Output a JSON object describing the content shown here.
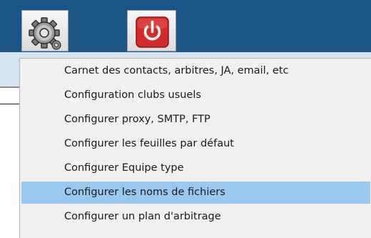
{
  "toolbar": {
    "settings_icon": "gear-icon",
    "power_icon": "power-icon"
  },
  "menu": {
    "selected_index": 5,
    "items": [
      {
        "label": "Carnet des contacts, arbitres, JA, email, etc"
      },
      {
        "label": "Configuration clubs usuels"
      },
      {
        "label": "Configurer proxy, SMTP, FTP"
      },
      {
        "label": "Configurer les feuilles par défaut"
      },
      {
        "label": "Configurer Equipe type"
      },
      {
        "label": "Configurer les noms de fichiers"
      },
      {
        "label": "Configurer un plan d'arbitrage"
      }
    ]
  },
  "colors": {
    "toolbar_bg": "#1b5585",
    "subbar_bg": "#d4e4f3",
    "menu_bg": "#f0f0f0",
    "highlight": "#99c9ef",
    "power_red": "#d42a2a"
  }
}
